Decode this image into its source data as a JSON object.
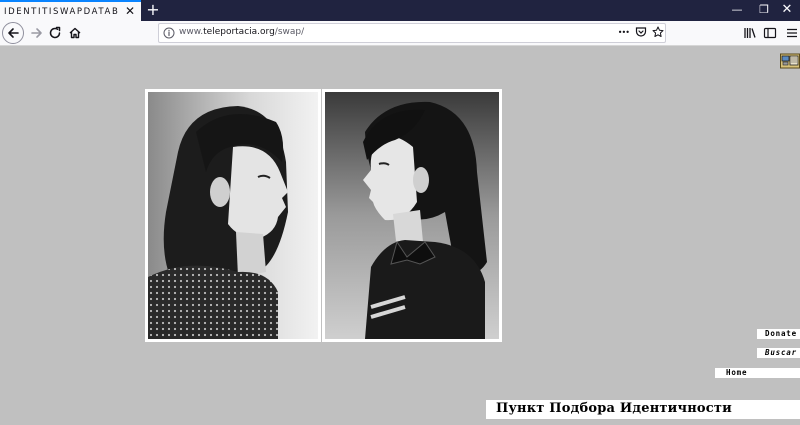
{
  "browser": {
    "tab_title": "IDENTITISWAPDATABAS",
    "tab_close": "✕",
    "new_tab": "+",
    "window_controls": {
      "minimize": "—",
      "restore": "❐",
      "close": "✕"
    },
    "url_scheme_host": "www.",
    "url_domain": "teleportacia.org",
    "url_path": "/swap/",
    "url_actions": {
      "more": "•••"
    }
  },
  "page": {
    "links": {
      "donate": "Donate",
      "buscar": "Buscar",
      "home": "Home"
    },
    "banner": "Пункт Подбора Идентичности",
    "photos": [
      {
        "name": "portrait-left",
        "subject": "girl facing right, black and white"
      },
      {
        "name": "portrait-right",
        "subject": "girl in profile facing left, black and white"
      }
    ],
    "colors": {
      "background": "#c0c0c0",
      "titlebar": "#202340",
      "accent": "#0a84ff"
    }
  }
}
